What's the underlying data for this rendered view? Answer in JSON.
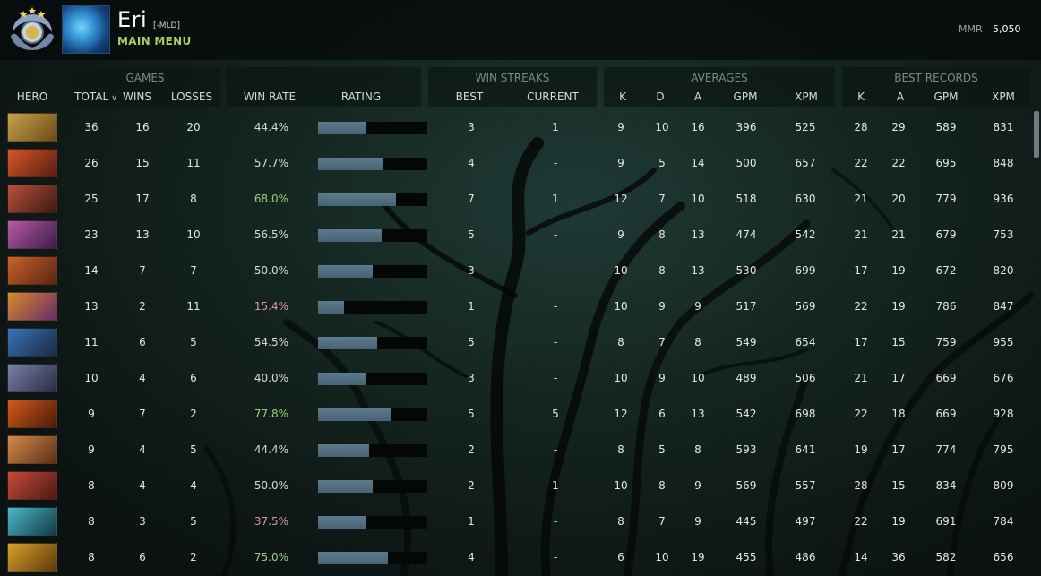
{
  "player": {
    "name": "Eri",
    "tag": "[-MLD]",
    "menu_link": "MAIN MENU",
    "mmr_label": "MMR",
    "mmr_value": "5,050"
  },
  "header": {
    "groups": {
      "games": "GAMES",
      "win_streaks": "WIN STREAKS",
      "averages": "AVERAGES",
      "best_records": "BEST RECORDS"
    },
    "columns": {
      "hero": "HERO",
      "total": "TOTAL",
      "wins": "WINS",
      "losses": "LOSSES",
      "win_rate": "WIN RATE",
      "rating": "RATING",
      "best": "BEST",
      "current": "CURRENT",
      "avg_k": "K",
      "avg_d": "D",
      "avg_a": "A",
      "avg_gpm": "GPM",
      "avg_xpm": "XPM",
      "rec_k": "K",
      "rec_a": "A",
      "rec_gpm": "GPM",
      "rec_xpm": "XPM"
    }
  },
  "rows": [
    {
      "total": "36",
      "wins": "16",
      "losses": "20",
      "win_rate": "44.4%",
      "rating": 0.44,
      "best": "3",
      "current": "1",
      "k": "9",
      "d": "10",
      "a": "16",
      "gpm": "396",
      "xpm": "525",
      "rk": "28",
      "ra": "29",
      "rgpm": "589",
      "rxpm": "831",
      "portrait": [
        "#c9a24a",
        "#6a4a1c"
      ]
    },
    {
      "total": "26",
      "wins": "15",
      "losses": "11",
      "win_rate": "57.7%",
      "rating": 0.6,
      "best": "4",
      "current": "-",
      "k": "9",
      "d": "5",
      "a": "14",
      "gpm": "500",
      "xpm": "657",
      "rk": "22",
      "ra": "22",
      "rgpm": "695",
      "rxpm": "848",
      "portrait": [
        "#d4572a",
        "#5a1d10"
      ]
    },
    {
      "total": "25",
      "wins": "17",
      "losses": "8",
      "win_rate": "68.0%",
      "rating": 0.71,
      "best": "7",
      "current": "1",
      "k": "12",
      "d": "7",
      "a": "10",
      "gpm": "518",
      "xpm": "630",
      "rk": "21",
      "ra": "20",
      "rgpm": "779",
      "rxpm": "936",
      "portrait": [
        "#b8503a",
        "#3c1a14"
      ]
    },
    {
      "total": "23",
      "wins": "13",
      "losses": "10",
      "win_rate": "56.5%",
      "rating": 0.58,
      "best": "5",
      "current": "-",
      "k": "9",
      "d": "8",
      "a": "13",
      "gpm": "474",
      "xpm": "542",
      "rk": "21",
      "ra": "21",
      "rgpm": "679",
      "rxpm": "753",
      "portrait": [
        "#b85aa4",
        "#3b1c4a"
      ]
    },
    {
      "total": "14",
      "wins": "7",
      "losses": "7",
      "win_rate": "50.0%",
      "rating": 0.5,
      "best": "3",
      "current": "-",
      "k": "10",
      "d": "8",
      "a": "13",
      "gpm": "530",
      "xpm": "699",
      "rk": "17",
      "ra": "19",
      "rgpm": "672",
      "rxpm": "820",
      "portrait": [
        "#c8622a",
        "#5b2412"
      ]
    },
    {
      "total": "13",
      "wins": "2",
      "losses": "11",
      "win_rate": "15.4%",
      "rating": 0.24,
      "best": "1",
      "current": "-",
      "k": "10",
      "d": "9",
      "a": "9",
      "gpm": "517",
      "xpm": "569",
      "rk": "22",
      "ra": "19",
      "rgpm": "786",
      "rxpm": "847",
      "portrait": [
        "#d88a2a",
        "#6a2a6a"
      ]
    },
    {
      "total": "11",
      "wins": "6",
      "losses": "5",
      "win_rate": "54.5%",
      "rating": 0.54,
      "best": "5",
      "current": "-",
      "k": "8",
      "d": "7",
      "a": "8",
      "gpm": "549",
      "xpm": "654",
      "rk": "17",
      "ra": "15",
      "rgpm": "759",
      "rxpm": "955",
      "portrait": [
        "#3a74b8",
        "#1a2a44"
      ]
    },
    {
      "total": "10",
      "wins": "4",
      "losses": "6",
      "win_rate": "40.0%",
      "rating": 0.44,
      "best": "3",
      "current": "-",
      "k": "10",
      "d": "9",
      "a": "10",
      "gpm": "489",
      "xpm": "506",
      "rk": "21",
      "ra": "17",
      "rgpm": "669",
      "rxpm": "676",
      "portrait": [
        "#7a80a8",
        "#2a2c44"
      ]
    },
    {
      "total": "9",
      "wins": "7",
      "losses": "2",
      "win_rate": "77.8%",
      "rating": 0.66,
      "best": "5",
      "current": "5",
      "k": "12",
      "d": "6",
      "a": "13",
      "gpm": "542",
      "xpm": "698",
      "rk": "22",
      "ra": "18",
      "rgpm": "669",
      "rxpm": "928",
      "portrait": [
        "#d25a1a",
        "#4a1a0a"
      ]
    },
    {
      "total": "9",
      "wins": "4",
      "losses": "5",
      "win_rate": "44.4%",
      "rating": 0.47,
      "best": "2",
      "current": "-",
      "k": "8",
      "d": "5",
      "a": "8",
      "gpm": "593",
      "xpm": "641",
      "rk": "19",
      "ra": "17",
      "rgpm": "774",
      "rxpm": "795",
      "portrait": [
        "#d48a4a",
        "#5a3018"
      ]
    },
    {
      "total": "8",
      "wins": "4",
      "losses": "4",
      "win_rate": "50.0%",
      "rating": 0.5,
      "best": "2",
      "current": "1",
      "k": "10",
      "d": "8",
      "a": "9",
      "gpm": "569",
      "xpm": "557",
      "rk": "28",
      "ra": "15",
      "rgpm": "834",
      "rxpm": "809",
      "portrait": [
        "#c84a3a",
        "#4a1a16"
      ]
    },
    {
      "total": "8",
      "wins": "3",
      "losses": "5",
      "win_rate": "37.5%",
      "rating": 0.44,
      "best": "1",
      "current": "-",
      "k": "8",
      "d": "7",
      "a": "9",
      "gpm": "445",
      "xpm": "497",
      "rk": "22",
      "ra": "19",
      "rgpm": "691",
      "rxpm": "784",
      "portrait": [
        "#4ab8c8",
        "#123a44"
      ]
    },
    {
      "total": "8",
      "wins": "6",
      "losses": "2",
      "win_rate": "75.0%",
      "rating": 0.64,
      "best": "4",
      "current": "-",
      "k": "6",
      "d": "10",
      "a": "19",
      "gpm": "455",
      "xpm": "486",
      "rk": "14",
      "ra": "36",
      "rgpm": "582",
      "rxpm": "656",
      "portrait": [
        "#d8a02a",
        "#5a3a0c"
      ]
    }
  ]
}
